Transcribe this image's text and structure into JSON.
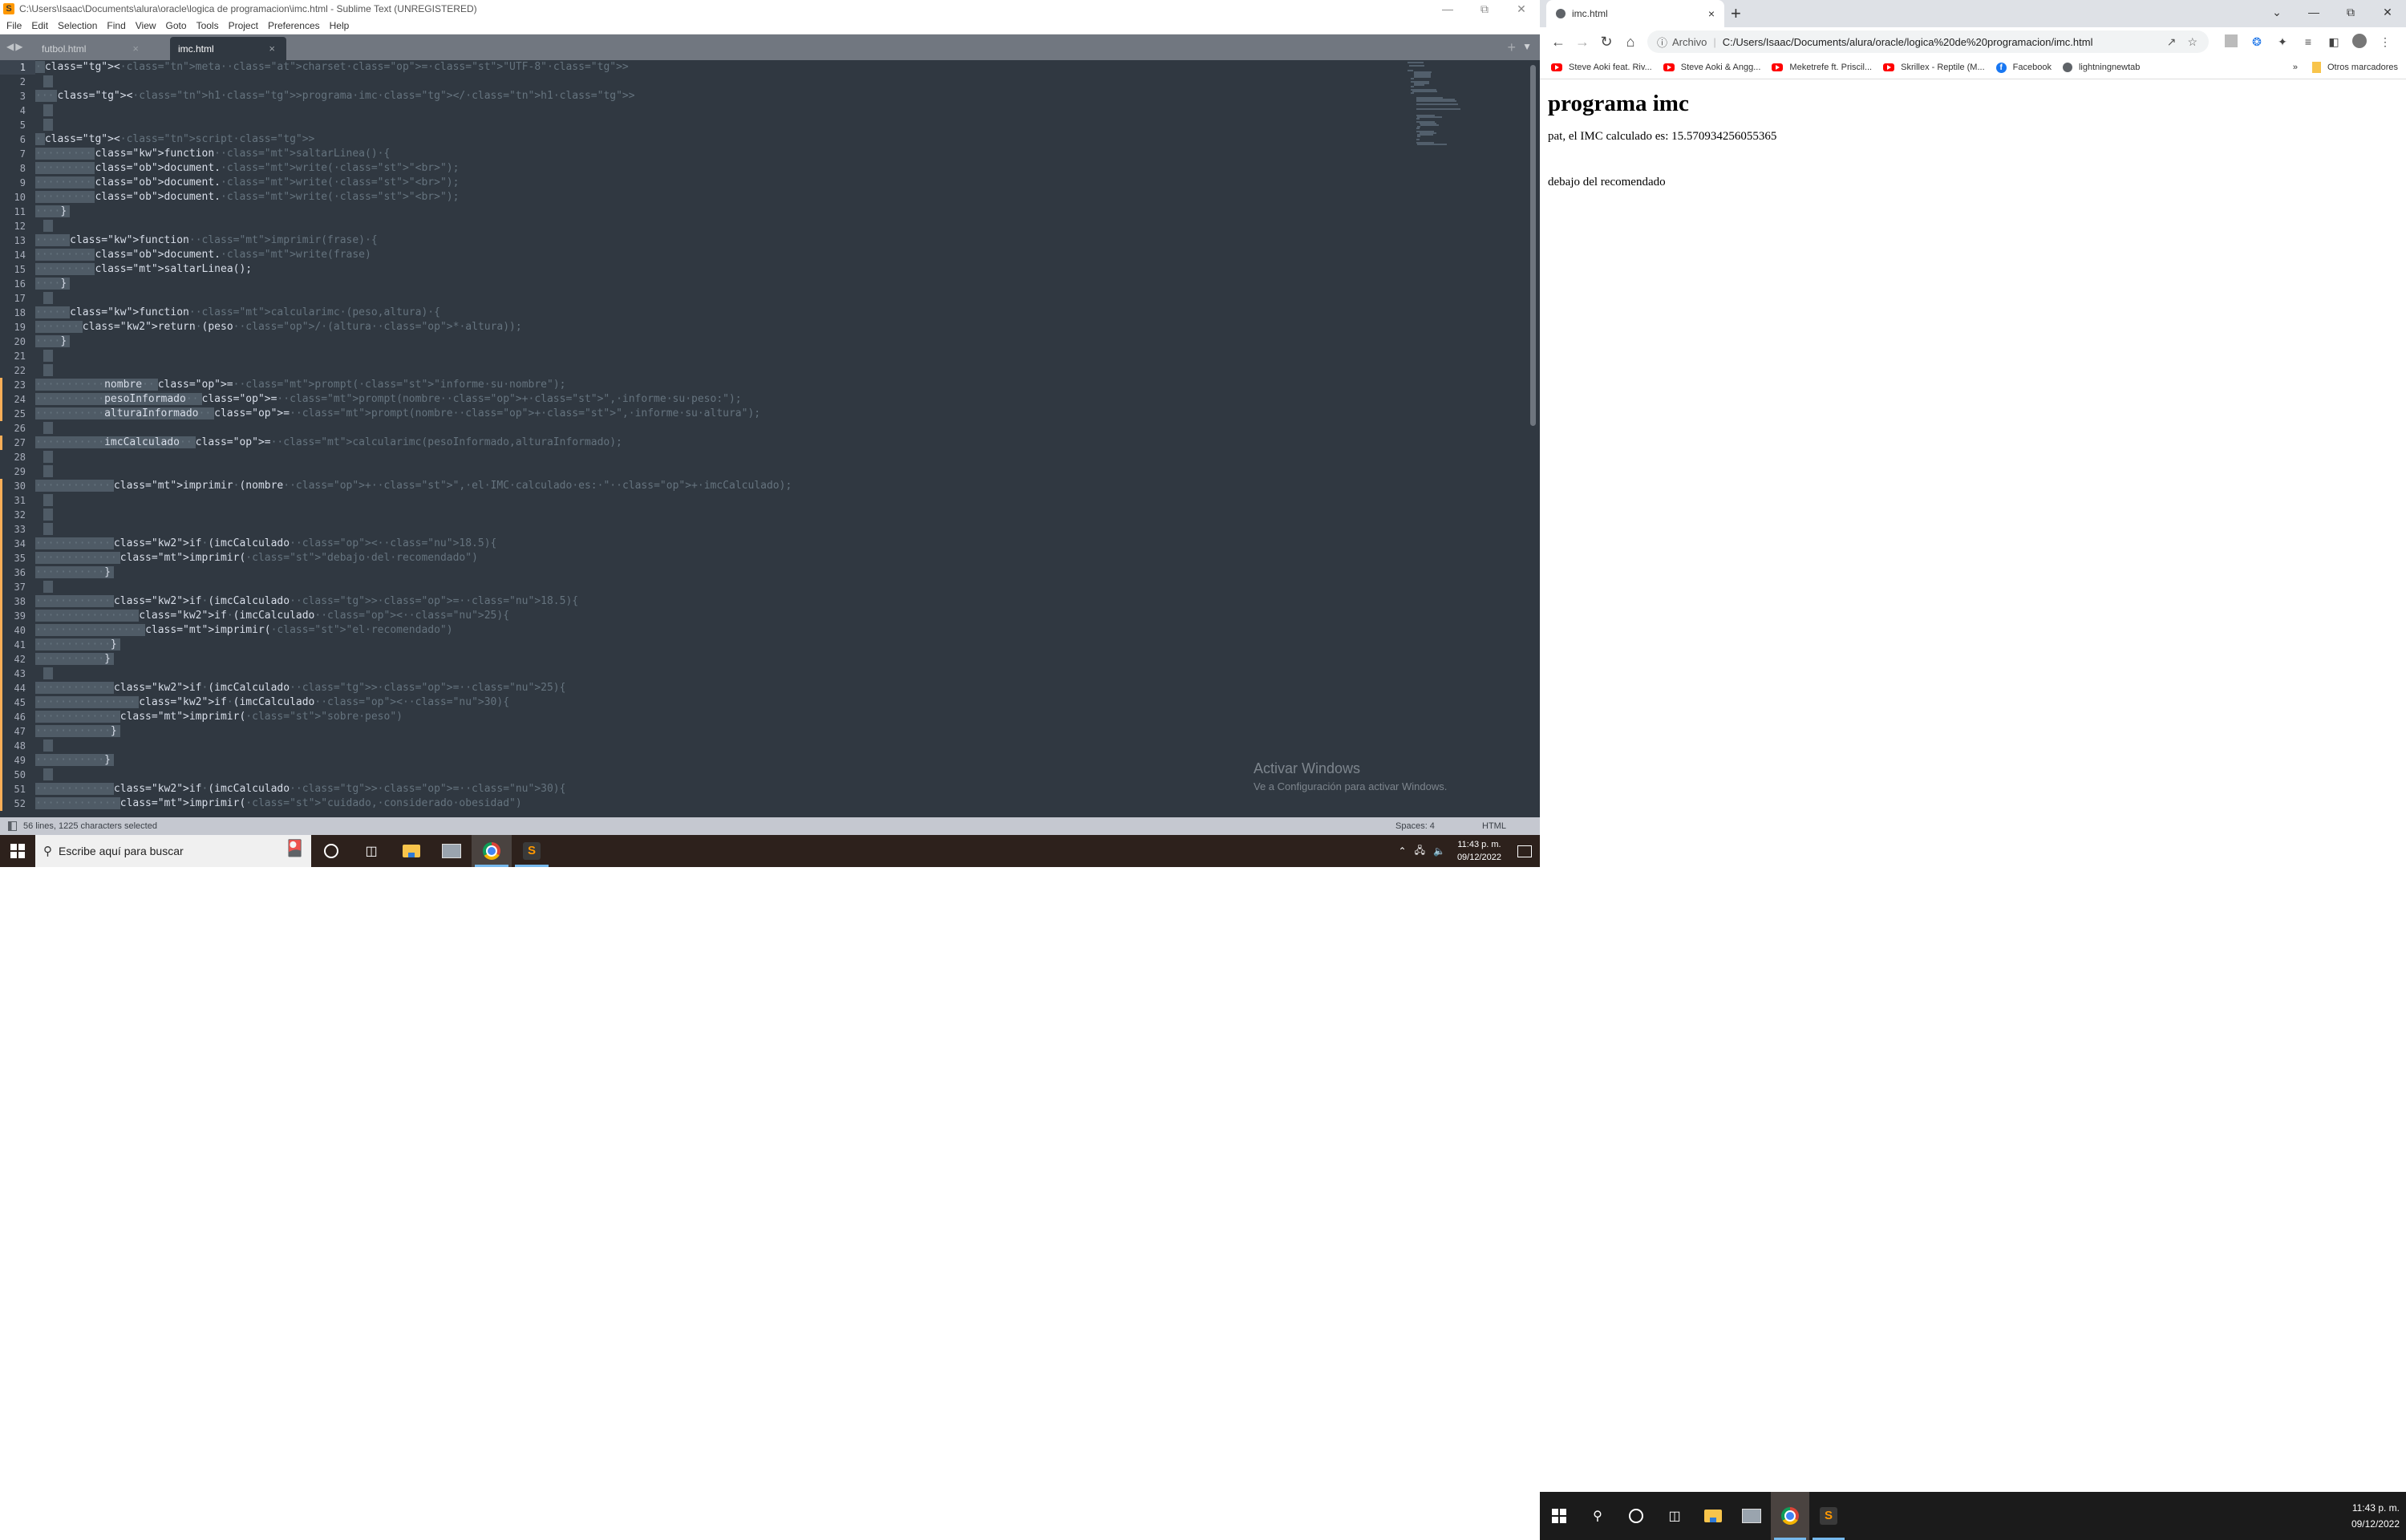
{
  "sublime": {
    "title": "C:\\Users\\Isaac\\Documents\\alura\\oracle\\logica de programacion\\imc.html - Sublime Text (UNREGISTERED)",
    "menu": [
      "File",
      "Edit",
      "Selection",
      "Find",
      "View",
      "Goto",
      "Tools",
      "Project",
      "Preferences",
      "Help"
    ],
    "tabs": [
      {
        "label": "futbol.html",
        "active": false
      },
      {
        "label": "imc.html",
        "active": true
      }
    ],
    "status": {
      "selection": "56 lines, 1225 characters selected",
      "indentation": "Spaces: 4",
      "syntax": "HTML"
    },
    "watermark": {
      "title": "Activar Windows",
      "subtitle": "Ve a Configuración para activar Windows."
    },
    "code_lines": [
      "<meta charset=\"UTF-8\">",
      "",
      "  <h1>programa imc</h1>",
      "",
      "",
      "<script>",
      "        function saltarLinea() {",
      "        document.write(\"<br>\");",
      "        document.write(\"<br>\");",
      "        document.write(\"<br>\");",
      "    }",
      "",
      "    function imprimir(frase) {",
      "        document.write(frase)",
      "        saltarLinea();",
      "    }",
      "",
      "    function calcularimc (peso,altura) {",
      "      return (peso / (altura * altura));",
      "    }",
      "",
      "",
      "           nombre = prompt(\"informe su nombre\");",
      "           pesoInformado = prompt(nombre +\", informe su peso:\");",
      "           alturaInformado = prompt(nombre +\", informe su altura\");",
      "",
      "           imcCalculado = calcularimc(pesoInformado,alturaInformado);",
      "",
      "",
      "           imprimir (nombre + \", el IMC calculado es: \" + imcCalculado);",
      "",
      "",
      "",
      "           if (imcCalculado < 18.5){",
      "            imprimir(\"debajo del recomendado\")",
      "           }",
      "",
      "           if (imcCalculado >= 18.5){",
      "               if (imcCalculado < 25){",
      "                imprimir(\"el recomendado\")",
      "            }",
      "           }",
      "",
      "           if (imcCalculado >= 25){",
      "               if (imcCalculado < 30){",
      "            imprimir(\"sobre peso\")",
      "            }",
      "",
      "           }",
      "",
      "           if (imcCalculado >= 30){",
      "            imprimir(\"cuidado, considerado obesidad\")"
    ],
    "modified_lines": [
      23,
      24,
      25,
      27,
      30,
      31,
      32,
      33,
      34,
      35,
      36,
      37,
      38,
      39,
      40,
      41,
      42,
      43,
      44,
      45,
      46,
      47,
      48,
      49,
      50,
      51,
      52
    ]
  },
  "taskbar_left": {
    "search_placeholder": "Escribe aquí para buscar",
    "time": "11:43 p. m.",
    "date": "09/12/2022"
  },
  "chrome": {
    "tab_title": "imc.html",
    "address_label": "Archivo",
    "url": "C:/Users/Isaac/Documents/alura/oracle/logica%20de%20programacion/imc.html",
    "bookmarks": [
      {
        "label": "Steve Aoki feat. Riv...",
        "icon": "youtube-icon"
      },
      {
        "label": "Steve Aoki & Angg...",
        "icon": "youtube-icon"
      },
      {
        "label": "Meketrefe ft. Priscil...",
        "icon": "youtube-icon"
      },
      {
        "label": "Skrillex - Reptile (M...",
        "icon": "youtube-icon"
      },
      {
        "label": "Facebook",
        "icon": "facebook-icon"
      },
      {
        "label": "lightningnewtab",
        "icon": "globe-icon"
      }
    ],
    "bookmarks_overflow": "»",
    "other_bookmarks": "Otros marcadores",
    "page": {
      "heading": "programa imc",
      "result_line": "pat, el IMC calculado es: 15.570934256055365",
      "classification": "debajo del recomendado"
    }
  },
  "taskbar_right": {
    "time": "11:43 p. m.",
    "date": "09/12/2022"
  }
}
